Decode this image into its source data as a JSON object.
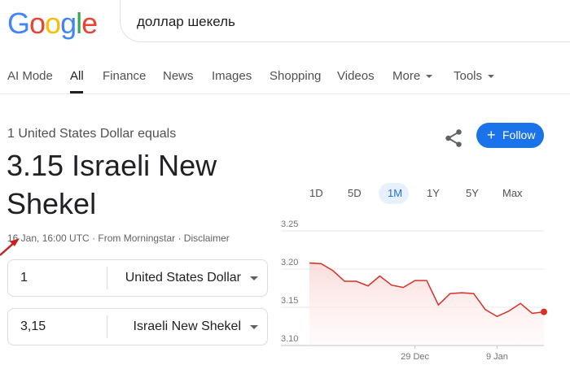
{
  "logo": {
    "letters": [
      "G",
      "o",
      "o",
      "g",
      "l",
      "e"
    ]
  },
  "search": {
    "query": "доллар шекель"
  },
  "tabs": [
    {
      "label": "AI Mode"
    },
    {
      "label": "All"
    },
    {
      "label": "Finance"
    },
    {
      "label": "News"
    },
    {
      "label": "Images"
    },
    {
      "label": "Shopping"
    },
    {
      "label": "Videos"
    },
    {
      "label": "More"
    },
    {
      "label": "Tools"
    }
  ],
  "result": {
    "equals_text": "1 United States Dollar equals",
    "value_line": "3.15 Israeli New Shekel",
    "timestamp": "16 Jan, 16:00 UTC",
    "source": "From Morningstar",
    "disclaimer": "Disclaimer",
    "separator": "·"
  },
  "converter": {
    "from": {
      "amount": "1",
      "currency": "United States Dollar"
    },
    "to": {
      "amount": "3,15",
      "currency": "Israeli New Shekel"
    }
  },
  "actions": {
    "follow_label": "Follow",
    "share_icon": "share-icon"
  },
  "ranges": [
    {
      "label": "1D"
    },
    {
      "label": "5D"
    },
    {
      "label": "1M",
      "selected": true
    },
    {
      "label": "1Y"
    },
    {
      "label": "5Y"
    },
    {
      "label": "Max"
    }
  ],
  "colors": {
    "accent": "#1a73e8",
    "line": "#d93025"
  },
  "chart_data": {
    "type": "line",
    "y_ticks": [
      "3.25",
      "3.20",
      "3.15",
      "3.10"
    ],
    "ylim": [
      3.1,
      3.25
    ],
    "x_tick_labels": [
      {
        "label": "29 Dec",
        "index": 9
      },
      {
        "label": "9 Jan",
        "index": 16
      }
    ],
    "series": [
      {
        "values": [
          3.208,
          3.207,
          3.198,
          3.184,
          3.184,
          3.178,
          3.191,
          3.179,
          3.176,
          3.185,
          3.185,
          3.153,
          3.168,
          3.169,
          3.168,
          3.147,
          3.138,
          3.145,
          3.155,
          3.142,
          3.144
        ]
      }
    ]
  }
}
